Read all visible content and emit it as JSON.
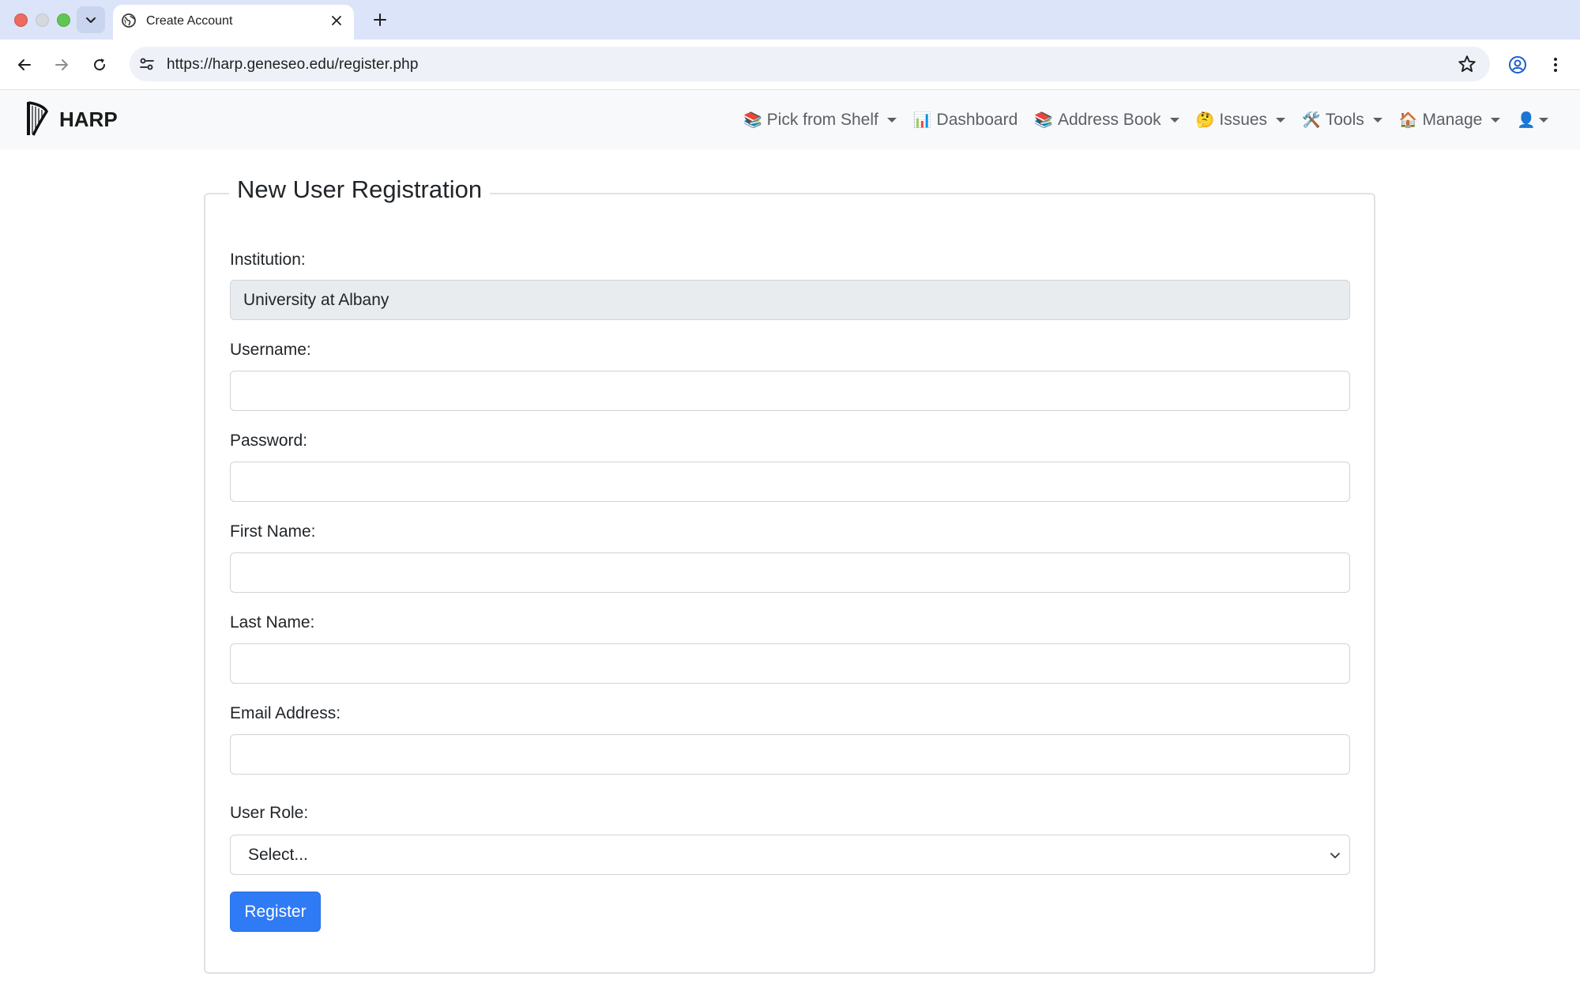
{
  "browser": {
    "tab_title": "Create Account",
    "url": "https://harp.geneseo.edu/register.php"
  },
  "navbar": {
    "brand": "HARP",
    "items": [
      {
        "icon": "📚",
        "label": "Pick from Shelf",
        "dropdown": true
      },
      {
        "icon": "📊",
        "label": "Dashboard",
        "dropdown": false
      },
      {
        "icon": "📚",
        "label": "Address Book",
        "dropdown": true
      },
      {
        "icon": "🤔",
        "label": "Issues",
        "dropdown": true
      },
      {
        "icon": "🛠️",
        "label": "Tools",
        "dropdown": true
      },
      {
        "icon": "🏠",
        "label": "Manage",
        "dropdown": true
      }
    ],
    "user_icon": "👤"
  },
  "form": {
    "legend": "New User Registration",
    "institution": {
      "label": "Institution:",
      "value": "University at Albany"
    },
    "username": {
      "label": "Username:",
      "value": ""
    },
    "password": {
      "label": "Password:",
      "value": ""
    },
    "first_name": {
      "label": "First Name:",
      "value": ""
    },
    "last_name": {
      "label": "Last Name:",
      "value": ""
    },
    "email": {
      "label": "Email Address:",
      "value": ""
    },
    "user_role": {
      "label": "User Role:",
      "selected": "Select..."
    },
    "submit_label": "Register"
  },
  "colors": {
    "primary": "#2f7bf5",
    "tabbar": "#dbe4f8",
    "navbar_bg": "#f8f9fa"
  }
}
